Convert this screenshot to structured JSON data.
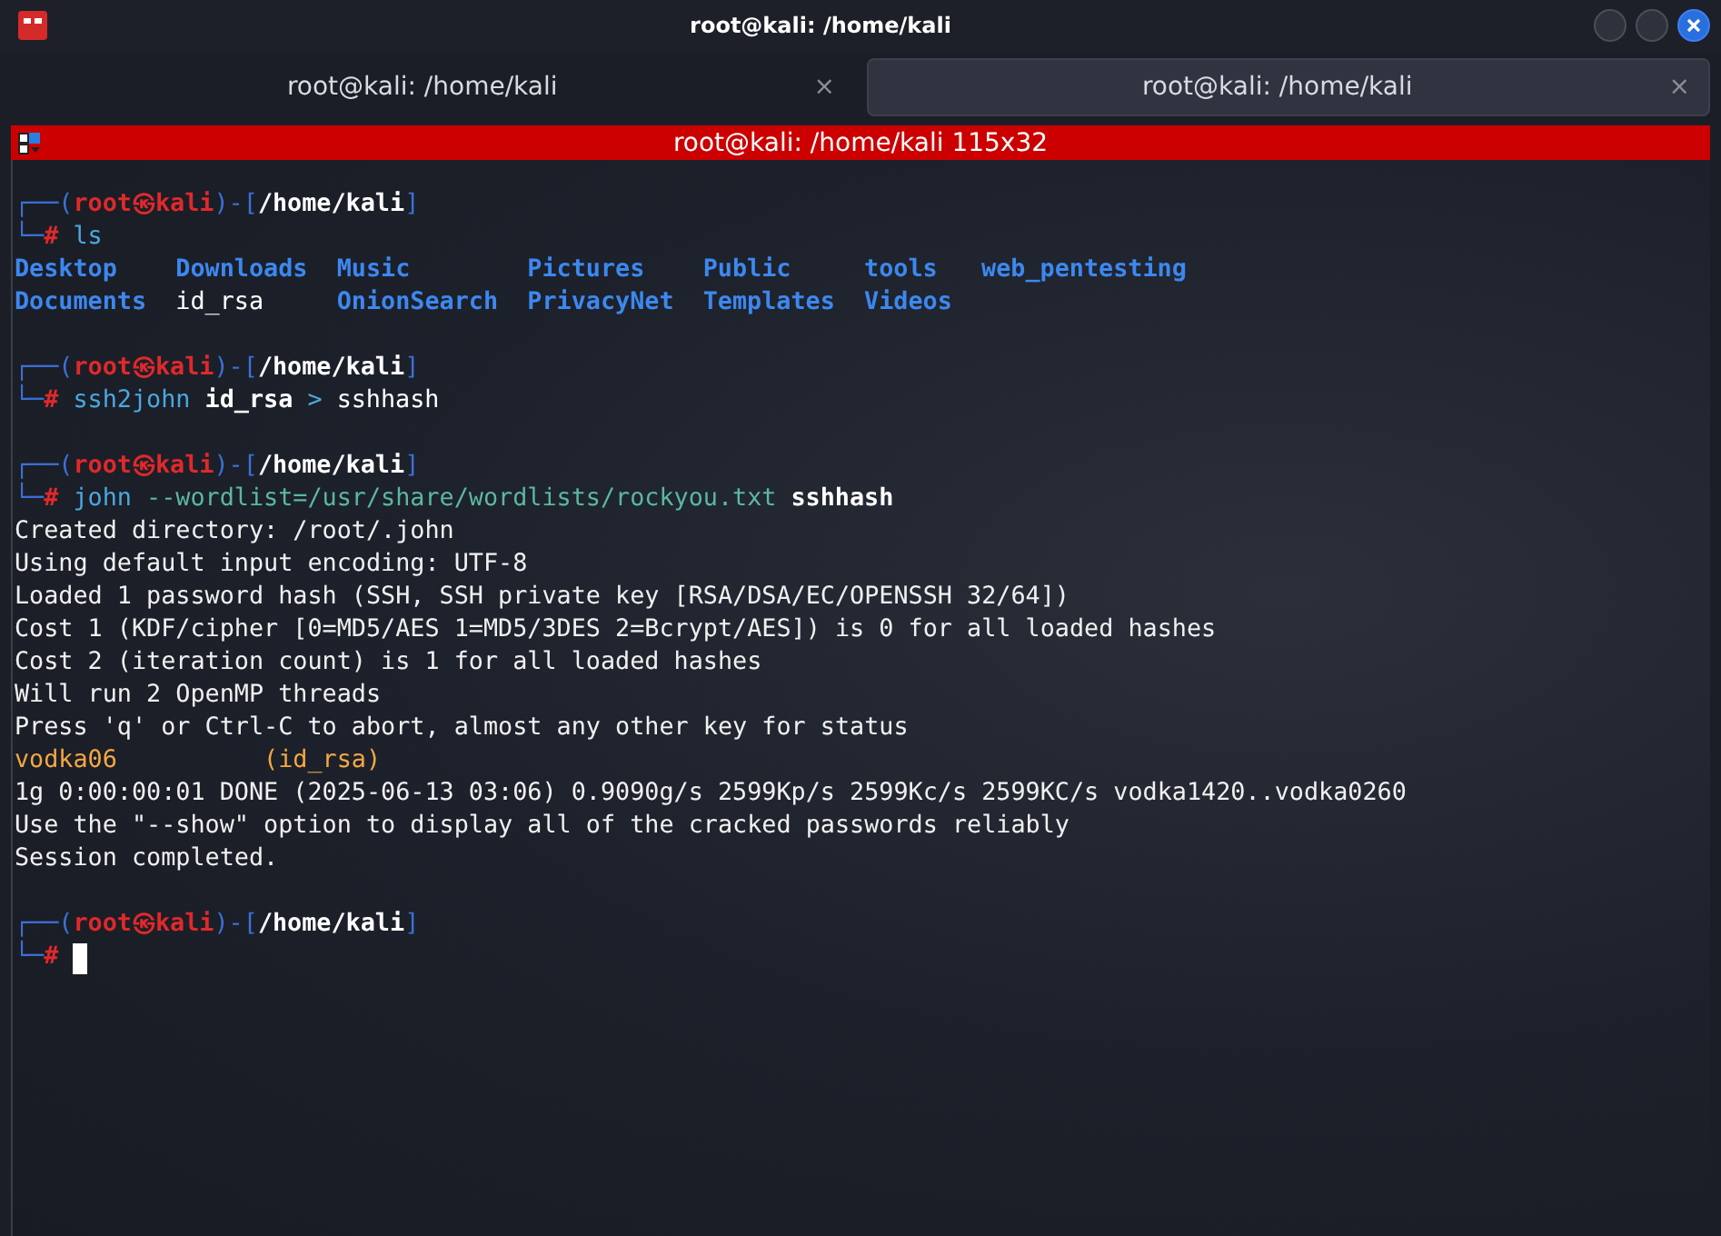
{
  "window": {
    "title": "root@kali: /home/kali"
  },
  "tabs": [
    {
      "label": "root@kali: /home/kali",
      "close": "×",
      "selected": false
    },
    {
      "label": "root@kali: /home/kali",
      "close": "×",
      "selected": true
    }
  ],
  "session_bar": {
    "title": "root@kali: /home/kali 115x32"
  },
  "terminal": {
    "lines": [
      {
        "kind": "prompt_top",
        "segments": [
          {
            "kind": "frame",
            "text": "┌──("
          },
          {
            "kind": "user",
            "text": "root㉿kali"
          },
          {
            "kind": "frame",
            "text": ")-["
          },
          {
            "kind": "path",
            "text": "/home/kali"
          },
          {
            "kind": "frame",
            "text": "]"
          }
        ]
      },
      {
        "kind": "prompt_cmd",
        "segments": [
          {
            "kind": "frame",
            "text": "└─"
          },
          {
            "kind": "hash",
            "text": "#"
          },
          {
            "kind": "command",
            "text": "ls"
          }
        ]
      },
      {
        "kind": "listing",
        "items": [
          {
            "text": "Desktop",
            "kind": "dir"
          },
          {
            "text": "Documents",
            "kind": "dir"
          },
          {
            "text": "Downloads",
            "kind": "dir"
          },
          {
            "text": "id_rsa",
            "kind": "file"
          },
          {
            "text": "Music",
            "kind": "dir"
          },
          {
            "text": "OnionSearch",
            "kind": "dir"
          },
          {
            "text": "Pictures",
            "kind": "dir"
          },
          {
            "text": "PrivacyNet",
            "kind": "dir"
          },
          {
            "text": "Public",
            "kind": "dir"
          },
          {
            "text": "Templates",
            "kind": "dir"
          },
          {
            "text": "tools",
            "kind": "dir"
          },
          {
            "text": "Videos",
            "kind": "dir"
          },
          {
            "text": "web_pentesting",
            "kind": "dir"
          }
        ]
      },
      {
        "kind": "blank"
      },
      {
        "kind": "prompt_top",
        "segments": [
          {
            "kind": "frame",
            "text": "┌──("
          },
          {
            "kind": "user",
            "text": "root㉿kali"
          },
          {
            "kind": "frame",
            "text": ")-["
          },
          {
            "kind": "path",
            "text": "/home/kali"
          },
          {
            "kind": "frame",
            "text": "]"
          }
        ]
      },
      {
        "kind": "prompt_cmd",
        "segments": [
          {
            "kind": "frame",
            "text": "└─"
          },
          {
            "kind": "hash",
            "text": "#"
          },
          {
            "kind": "command",
            "text": "ssh2john"
          },
          {
            "kind": "bold",
            "text": "id_rsa"
          },
          {
            "kind": "operator",
            "text": ">"
          },
          {
            "kind": "plain",
            "text": "sshhash"
          }
        ]
      },
      {
        "kind": "blank"
      },
      {
        "kind": "prompt_top",
        "segments": [
          {
            "kind": "frame",
            "text": "┌──("
          },
          {
            "kind": "user",
            "text": "root㉿kali"
          },
          {
            "kind": "frame",
            "text": ")-["
          },
          {
            "kind": "path",
            "text": "/home/kali"
          },
          {
            "kind": "frame",
            "text": "]"
          }
        ]
      },
      {
        "kind": "prompt_cmd",
        "segments": [
          {
            "kind": "frame",
            "text": "└─"
          },
          {
            "kind": "hash",
            "text": "#"
          },
          {
            "kind": "command",
            "text": "john"
          },
          {
            "kind": "option",
            "text": "--wordlist=/usr/share/wordlists/rockyou.txt"
          },
          {
            "kind": "bold",
            "text": "sshhash"
          }
        ]
      },
      {
        "kind": "output",
        "text": "Created directory: /root/.john"
      },
      {
        "kind": "output",
        "text": "Using default input encoding: UTF-8"
      },
      {
        "kind": "output",
        "text": "Loaded 1 password hash (SSH, SSH private key [RSA/DSA/EC/OPENSSH 32/64])"
      },
      {
        "kind": "output",
        "text": "Cost 1 (KDF/cipher [0=MD5/AES 1=MD5/3DES 2=Bcrypt/AES]) is 0 for all loaded hashes"
      },
      {
        "kind": "output",
        "text": "Cost 2 (iteration count) is 1 for all loaded hashes"
      },
      {
        "kind": "output",
        "text": "Will run 2 OpenMP threads"
      },
      {
        "kind": "output",
        "text": "Press 'q' or Ctrl-C to abort, almost any other key for status"
      },
      {
        "kind": "cracked",
        "password": "vodka06",
        "source": "(id_rsa)"
      },
      {
        "kind": "output",
        "text": "1g 0:00:00:01 DONE (2025-06-13 03:06) 0.9090g/s 2599Kp/s 2599Kc/s 2599KC/s vodka1420..vodka0260"
      },
      {
        "kind": "output",
        "text": "Use the \"--show\" option to display all of the cracked passwords reliably"
      },
      {
        "kind": "output",
        "text": "Session completed."
      },
      {
        "kind": "blank"
      },
      {
        "kind": "prompt_top",
        "segments": [
          {
            "kind": "frame",
            "text": "┌──("
          },
          {
            "kind": "user",
            "text": "root㉿kali"
          },
          {
            "kind": "frame",
            "text": ")-["
          },
          {
            "kind": "path",
            "text": "/home/kali"
          },
          {
            "kind": "frame",
            "text": "]"
          }
        ]
      },
      {
        "kind": "prompt_cmd",
        "cursor": true,
        "segments": [
          {
            "kind": "frame",
            "text": "└─"
          },
          {
            "kind": "hash",
            "text": "#"
          }
        ]
      }
    ]
  }
}
